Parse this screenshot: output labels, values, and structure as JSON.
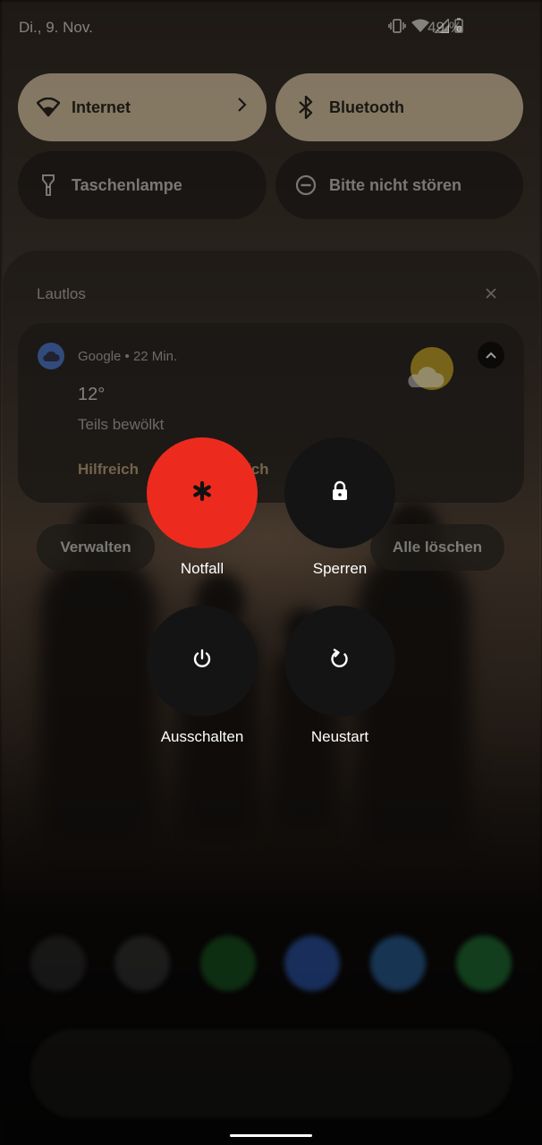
{
  "status_bar": {
    "date": "Di., 9. Nov.",
    "battery_percent": "49 %",
    "icons": [
      "vibrate-icon",
      "wifi-icon",
      "signal-icon",
      "battery-icon"
    ]
  },
  "quick_settings": {
    "tiles": [
      {
        "label": "Internet",
        "icon": "wifi-icon",
        "active": true
      },
      {
        "label": "Bluetooth",
        "icon": "bluetooth-icon",
        "active": true
      },
      {
        "label": "Taschenlampe",
        "icon": "flashlight-icon",
        "active": false
      },
      {
        "label": "Bitte nicht stören",
        "icon": "do-not-disturb-icon",
        "active": false
      }
    ]
  },
  "notifications": {
    "section_title": "Lautlos",
    "card": {
      "app": "Google",
      "time": "22 Min.",
      "app_line": "Google • 22 Min.",
      "title": "12°",
      "text": "Teils bewölkt",
      "action_1": "Hilfreich",
      "action_2_visible": "ich"
    },
    "manage_label": "Verwalten",
    "clear_all_label": "Alle löschen"
  },
  "power_menu": {
    "items": [
      {
        "label": "Notfall",
        "icon": "emergency-asterisk-icon"
      },
      {
        "label": "Sperren",
        "icon": "lock-icon"
      },
      {
        "label": "Ausschalten",
        "icon": "power-icon"
      },
      {
        "label": "Neustart",
        "icon": "restart-icon"
      }
    ]
  },
  "colors": {
    "emergency": "#ec2b1e",
    "power_button_bg": "#141414",
    "tile_active": "#d6c3a2",
    "accent_text": "#c9ac80"
  }
}
